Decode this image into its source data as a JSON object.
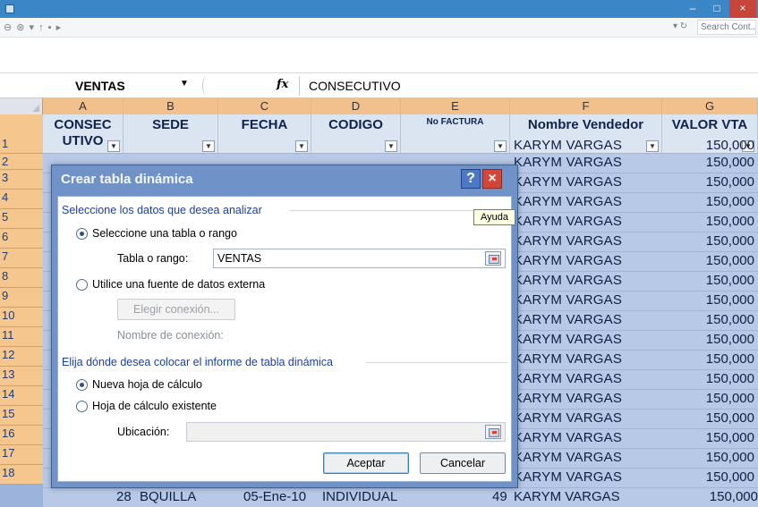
{
  "window": {
    "minimize": "–",
    "maximize": "□",
    "close": "×"
  },
  "address": {
    "nav": "⊖ ⊛ ▾ ↑ ▪ ▸",
    "refresh": "▾ ↻",
    "search_placeholder": "Search Cont... ⌕"
  },
  "formula_bar": {
    "name_box": "VENTAS",
    "name_arrow": "▼",
    "fx": "fx",
    "formula": "CONSECUTIVO"
  },
  "columns": [
    {
      "letter": "A",
      "header": "CONSEC UTIVO"
    },
    {
      "letter": "B",
      "header": "SEDE"
    },
    {
      "letter": "C",
      "header": "FECHA"
    },
    {
      "letter": "D",
      "header": "CODIGO"
    },
    {
      "letter": "E",
      "header": "No FACTURA"
    },
    {
      "letter": "F",
      "header": "Nombre Vendedor"
    },
    {
      "letter": "G",
      "header": "VALOR VTA"
    }
  ],
  "rows": [
    "1",
    "2",
    "3",
    "4",
    "5",
    "6",
    "7",
    "8",
    "9",
    "10",
    "11",
    "12",
    "13",
    "14",
    "15",
    "16",
    "17",
    "18"
  ],
  "data": {
    "vendor": "KARYM VARGAS",
    "value": "150,000",
    "last_row": {
      "a": "28",
      "b": "BQUILLA",
      "c": "05-Ene-10",
      "d": "INDIVIDUAL",
      "e": "49"
    }
  },
  "dialog": {
    "title": "Crear tabla dinámica",
    "help": "?",
    "close": "×",
    "group1": "Seleccione los datos que desea analizar",
    "opt_table": "Seleccione una tabla o rango",
    "table_range_label": "Tabla o rango:",
    "table_range_value": "VENTAS",
    "opt_external": "Utilice una fuente de datos externa",
    "choose_connection": "Elegir conexión...",
    "connection_name_label": "Nombre de conexión:",
    "group2": "Elija dónde desea colocar el informe de tabla dinámica",
    "opt_new_sheet": "Nueva hoja de cálculo",
    "opt_existing_sheet": "Hoja de cálculo existente",
    "location_label": "Ubicación:",
    "location_value": "",
    "ok": "Aceptar",
    "cancel": "Cancelar"
  },
  "tooltip": "Ayuda"
}
